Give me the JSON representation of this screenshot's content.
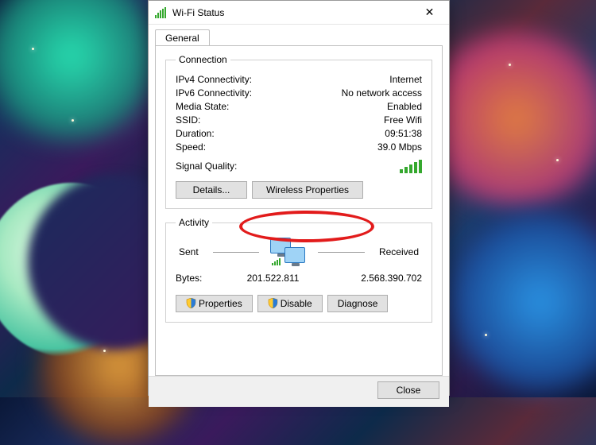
{
  "window": {
    "title": "Wi-Fi Status",
    "close_glyph": "✕"
  },
  "tab": {
    "general": "General"
  },
  "connection": {
    "legend": "Connection",
    "rows": {
      "ipv4_k": "IPv4 Connectivity:",
      "ipv4_v": "Internet",
      "ipv6_k": "IPv6 Connectivity:",
      "ipv6_v": "No network access",
      "media_k": "Media State:",
      "media_v": "Enabled",
      "ssid_k": "SSID:",
      "ssid_v": "Free Wifi",
      "dur_k": "Duration:",
      "dur_v": "09:51:38",
      "speed_k": "Speed:",
      "speed_v": "39.0 Mbps"
    },
    "signal_label": "Signal Quality:",
    "details_btn": "Details...",
    "wprops_btn": "Wireless Properties"
  },
  "activity": {
    "legend": "Activity",
    "sent_label": "Sent",
    "received_label": "Received",
    "bytes_label": "Bytes:",
    "bytes_sent": "201.522.811",
    "bytes_recv": "2.568.390.702",
    "props_btn": "Properties",
    "disable_btn": "Disable",
    "diagnose_btn": "Diagnose"
  },
  "footer": {
    "close_btn": "Close"
  },
  "colors": {
    "accent_green": "#35a82e",
    "highlight_red": "#e21b1b"
  }
}
